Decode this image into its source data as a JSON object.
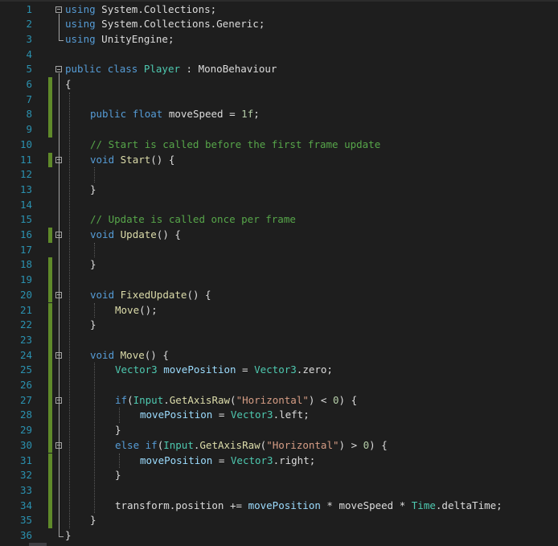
{
  "editor": {
    "colors": {
      "background": "#1e1e1e",
      "line_number": "#2b91af",
      "keyword": "#569cd6",
      "type": "#4ec9b0",
      "comment": "#57a64a",
      "string": "#d69d85",
      "number": "#b5cea8",
      "method": "#dcdcaa",
      "variable": "#9cdcfe",
      "text": "#dcdcdc",
      "change_marker": "#5f8a2a"
    },
    "lines": [
      {
        "n": "1",
        "chg": false,
        "fold": true,
        "indent": 0,
        "tokens": [
          [
            "kw",
            "using"
          ],
          [
            "tx",
            " System.Collections;"
          ]
        ]
      },
      {
        "n": "2",
        "chg": false,
        "fold": false,
        "indent": 0,
        "tokens": [
          [
            "kw",
            "using"
          ],
          [
            "tx",
            " System.Collections.Generic;"
          ]
        ]
      },
      {
        "n": "3",
        "chg": false,
        "fold": false,
        "indent": 0,
        "tokens": [
          [
            "kw",
            "using"
          ],
          [
            "tx",
            " UnityEngine;"
          ]
        ]
      },
      {
        "n": "4",
        "chg": false,
        "fold": false,
        "indent": 0,
        "tokens": []
      },
      {
        "n": "5",
        "chg": false,
        "fold": true,
        "indent": 0,
        "tokens": [
          [
            "kw",
            "public"
          ],
          [
            "tx",
            " "
          ],
          [
            "kw",
            "class"
          ],
          [
            "tx",
            " "
          ],
          [
            "ty",
            "Player"
          ],
          [
            "tx",
            " : MonoBehaviour"
          ]
        ]
      },
      {
        "n": "6",
        "chg": true,
        "fold": false,
        "indent": 0,
        "tokens": [
          [
            "tx",
            "{"
          ]
        ]
      },
      {
        "n": "7",
        "chg": true,
        "fold": false,
        "indent": 0,
        "tokens": []
      },
      {
        "n": "8",
        "chg": true,
        "fold": false,
        "indent": 1,
        "tokens": [
          [
            "kw",
            "public"
          ],
          [
            "tx",
            " "
          ],
          [
            "kw",
            "float"
          ],
          [
            "tx",
            " moveSpeed = "
          ],
          [
            "nm",
            "1f"
          ],
          [
            "tx",
            ";"
          ]
        ]
      },
      {
        "n": "9",
        "chg": true,
        "fold": false,
        "indent": 0,
        "tokens": []
      },
      {
        "n": "10",
        "chg": false,
        "fold": false,
        "indent": 1,
        "tokens": [
          [
            "cm",
            "// Start is called before the first frame update"
          ]
        ]
      },
      {
        "n": "11",
        "chg": true,
        "fold": true,
        "indent": 1,
        "tokens": [
          [
            "kw",
            "void"
          ],
          [
            "tx",
            " "
          ],
          [
            "fn",
            "Start"
          ],
          [
            "tx",
            "() {"
          ]
        ]
      },
      {
        "n": "12",
        "chg": false,
        "fold": false,
        "indent": 0,
        "tokens": []
      },
      {
        "n": "13",
        "chg": false,
        "fold": false,
        "indent": 1,
        "tokens": [
          [
            "tx",
            "}"
          ]
        ]
      },
      {
        "n": "14",
        "chg": false,
        "fold": false,
        "indent": 0,
        "tokens": []
      },
      {
        "n": "15",
        "chg": false,
        "fold": false,
        "indent": 1,
        "tokens": [
          [
            "cm",
            "// Update is called once per frame"
          ]
        ]
      },
      {
        "n": "16",
        "chg": true,
        "fold": true,
        "indent": 1,
        "tokens": [
          [
            "kw",
            "void"
          ],
          [
            "tx",
            " "
          ],
          [
            "fn",
            "Update"
          ],
          [
            "tx",
            "() {"
          ]
        ]
      },
      {
        "n": "17",
        "chg": false,
        "fold": false,
        "indent": 0,
        "tokens": []
      },
      {
        "n": "18",
        "chg": true,
        "fold": false,
        "indent": 1,
        "tokens": [
          [
            "tx",
            "}"
          ]
        ]
      },
      {
        "n": "19",
        "chg": true,
        "fold": false,
        "indent": 0,
        "tokens": []
      },
      {
        "n": "20",
        "chg": true,
        "fold": true,
        "indent": 1,
        "tokens": [
          [
            "kw",
            "void"
          ],
          [
            "tx",
            " "
          ],
          [
            "fn",
            "FixedUpdate"
          ],
          [
            "tx",
            "() {"
          ]
        ]
      },
      {
        "n": "21",
        "chg": true,
        "fold": false,
        "indent": 2,
        "tokens": [
          [
            "fn",
            "Move"
          ],
          [
            "tx",
            "();"
          ]
        ]
      },
      {
        "n": "22",
        "chg": true,
        "fold": false,
        "indent": 1,
        "tokens": [
          [
            "tx",
            "}"
          ]
        ]
      },
      {
        "n": "23",
        "chg": true,
        "fold": false,
        "indent": 0,
        "tokens": []
      },
      {
        "n": "24",
        "chg": true,
        "fold": true,
        "indent": 1,
        "tokens": [
          [
            "kw",
            "void"
          ],
          [
            "tx",
            " "
          ],
          [
            "fn",
            "Move"
          ],
          [
            "tx",
            "() {"
          ]
        ]
      },
      {
        "n": "25",
        "chg": true,
        "fold": false,
        "indent": 2,
        "tokens": [
          [
            "ty",
            "Vector3"
          ],
          [
            "tx",
            " "
          ],
          [
            "vr",
            "movePosition"
          ],
          [
            "tx",
            " = "
          ],
          [
            "ty",
            "Vector3"
          ],
          [
            "tx",
            ".zero;"
          ]
        ]
      },
      {
        "n": "26",
        "chg": true,
        "fold": false,
        "indent": 0,
        "tokens": []
      },
      {
        "n": "27",
        "chg": true,
        "fold": true,
        "indent": 2,
        "tokens": [
          [
            "kw",
            "if"
          ],
          [
            "tx",
            "("
          ],
          [
            "ty",
            "Input"
          ],
          [
            "tx",
            "."
          ],
          [
            "fn",
            "GetAxisRaw"
          ],
          [
            "tx",
            "("
          ],
          [
            "st",
            "\"Horizontal\""
          ],
          [
            "tx",
            ") < "
          ],
          [
            "nm",
            "0"
          ],
          [
            "tx",
            ") {"
          ]
        ]
      },
      {
        "n": "28",
        "chg": true,
        "fold": false,
        "indent": 3,
        "tokens": [
          [
            "vr",
            "movePosition"
          ],
          [
            "tx",
            " = "
          ],
          [
            "ty",
            "Vector3"
          ],
          [
            "tx",
            ".left;"
          ]
        ]
      },
      {
        "n": "29",
        "chg": true,
        "fold": false,
        "indent": 2,
        "tokens": [
          [
            "tx",
            "}"
          ]
        ]
      },
      {
        "n": "30",
        "chg": true,
        "fold": true,
        "indent": 2,
        "tokens": [
          [
            "kw",
            "else"
          ],
          [
            "tx",
            " "
          ],
          [
            "kw",
            "if"
          ],
          [
            "tx",
            "("
          ],
          [
            "ty",
            "Input"
          ],
          [
            "tx",
            "."
          ],
          [
            "fn",
            "GetAxisRaw"
          ],
          [
            "tx",
            "("
          ],
          [
            "st",
            "\"Horizontal\""
          ],
          [
            "tx",
            ") > "
          ],
          [
            "nm",
            "0"
          ],
          [
            "tx",
            ") {"
          ]
        ]
      },
      {
        "n": "31",
        "chg": true,
        "fold": false,
        "indent": 3,
        "tokens": [
          [
            "vr",
            "movePosition"
          ],
          [
            "tx",
            " = "
          ],
          [
            "ty",
            "Vector3"
          ],
          [
            "tx",
            ".right;"
          ]
        ]
      },
      {
        "n": "32",
        "chg": true,
        "fold": false,
        "indent": 2,
        "tokens": [
          [
            "tx",
            "}"
          ]
        ]
      },
      {
        "n": "33",
        "chg": true,
        "fold": false,
        "indent": 0,
        "tokens": []
      },
      {
        "n": "34",
        "chg": true,
        "fold": false,
        "indent": 2,
        "tokens": [
          [
            "tx",
            "transform.position += "
          ],
          [
            "vr",
            "movePosition"
          ],
          [
            "tx",
            " * moveSpeed * "
          ],
          [
            "ty",
            "Time"
          ],
          [
            "tx",
            ".deltaTime;"
          ]
        ]
      },
      {
        "n": "35",
        "chg": true,
        "fold": false,
        "indent": 1,
        "tokens": [
          [
            "tx",
            "}"
          ]
        ]
      },
      {
        "n": "36",
        "chg": false,
        "fold": false,
        "indent": 0,
        "tokens": [
          [
            "tx",
            "}"
          ]
        ]
      }
    ]
  }
}
